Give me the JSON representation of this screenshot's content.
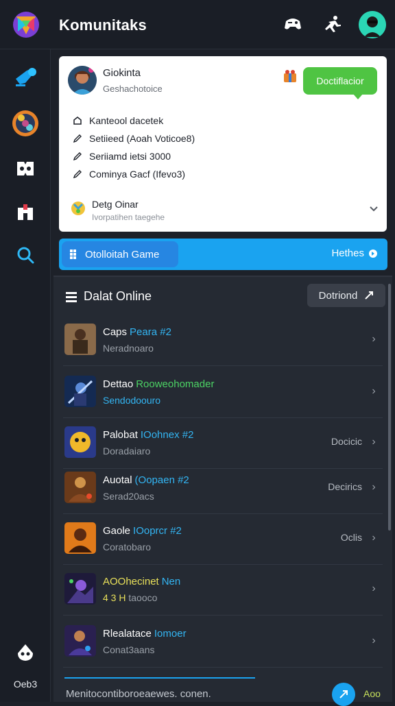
{
  "header": {
    "title": "Komunitaks",
    "icons": [
      "gamepad-icon",
      "runner-icon"
    ],
    "avatar": "avatar"
  },
  "sidebar": {
    "items": [
      {
        "name": "chat-bubble-icon"
      },
      {
        "name": "community-avatar-icon"
      },
      {
        "name": "controller-icon"
      },
      {
        "name": "store-icon"
      },
      {
        "name": "search-icon"
      }
    ],
    "bottom_icon": "alien-icon",
    "bottom_label": "Oeb3"
  },
  "profile_card": {
    "name": "Giokinta",
    "status": "Geshachotoice",
    "cta_label": "Doctiflacior",
    "details": [
      {
        "icon": "home-icon",
        "text": "Kanteool dacetek"
      },
      {
        "icon": "edit-icon",
        "text": "Setiieed (Aoah Voticoe8)"
      },
      {
        "icon": "edit-icon",
        "text": "Seriiamd ietsi 3000"
      },
      {
        "icon": "edit-icon",
        "text": "Cominya Gacf (Ifevo3)"
      }
    ],
    "device_title": "Detg Oinar",
    "device_sub": "Ivorpatihen taegehe"
  },
  "action_bar": {
    "button_label": "Otolloitah Game",
    "right_label": "Hethes"
  },
  "list": {
    "header": "Dalat Online",
    "download_label": "Dotriond",
    "accent": "#1aa3f0",
    "rows": [
      {
        "title": "Caps",
        "highlight": "Peara #2",
        "hl_color": "#33b6f4",
        "sub": "Neradnoaro",
        "sub_color": "#9aa0a8",
        "status": ""
      },
      {
        "title": "Dettao",
        "highlight": "Rooweohomader",
        "hl_color": "#4cd364",
        "sub": "Sendodoouro",
        "sub_color": "#33b6f4",
        "status": ""
      },
      {
        "title": "Palobat",
        "highlight": "IOohnex #2",
        "hl_color": "#33b6f4",
        "sub": "Doradaiaro",
        "sub_color": "#9aa0a8",
        "status": "Docicic"
      },
      {
        "title": "Auotal",
        "highlight": "(Oopaen #2",
        "hl_color": "#33b6f4",
        "sub": "Serad20acs",
        "sub_color": "#9aa0a8",
        "status": "Decirics"
      },
      {
        "title": "Gaole",
        "highlight": "IOoprcr #2",
        "hl_color": "#33b6f4",
        "sub": "Coratobaro",
        "sub_color": "#9aa0a8",
        "status": "Oclis"
      },
      {
        "title": "AOOhecinet",
        "highlight": "Nen",
        "hl_color": "#33b6f4",
        "title_color": "#e8e05a",
        "sub": "4 3 H",
        "sub_color": "#e8e05a",
        "sub_extra": "taooco",
        "status": ""
      },
      {
        "title": "Rlealatace",
        "highlight": "Iomoer",
        "hl_color": "#33b6f4",
        "sub": "Conat3aans",
        "sub_color": "#9aa0a8",
        "status": ""
      }
    ],
    "footer_text": "Menitocontiboroeaewes. conen.",
    "footer_label": "Aoo"
  }
}
